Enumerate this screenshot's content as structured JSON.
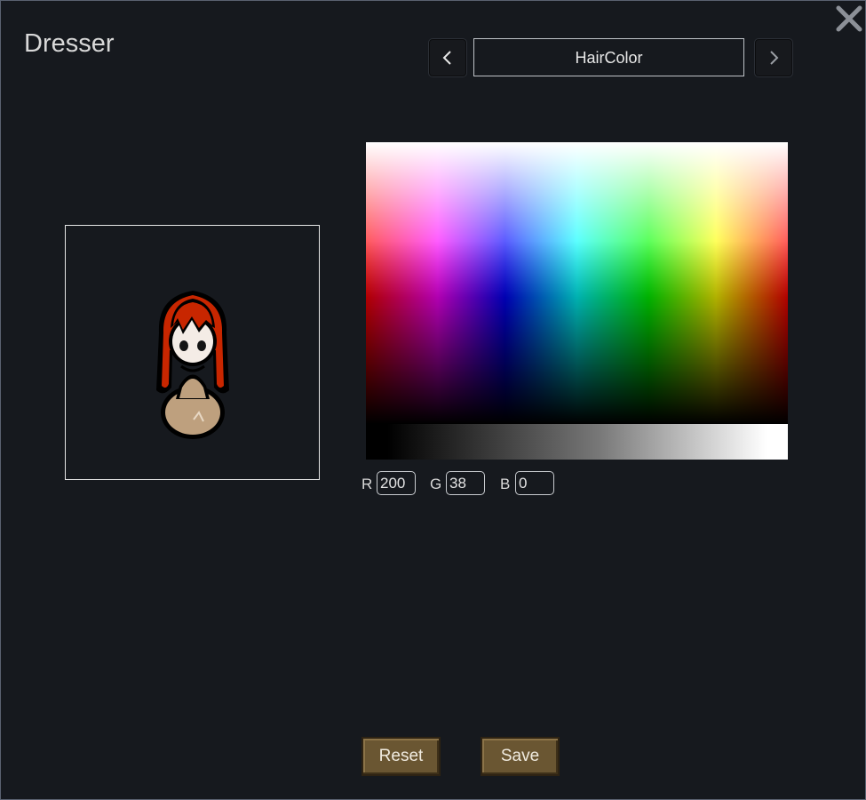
{
  "window": {
    "title": "Dresser",
    "close_icon": "close-icon"
  },
  "category_selector": {
    "prev_icon": "chevron-left-icon",
    "label": "HairColor",
    "next_icon": "chevron-right-icon"
  },
  "color": {
    "r_label": "R",
    "r_value": "200",
    "g_label": "G",
    "g_value": "38",
    "b_label": "B",
    "b_value": "0",
    "hair_hex": "#c82600"
  },
  "actions": {
    "reset_label": "Reset",
    "save_label": "Save"
  },
  "colors": {
    "background": "#16191e",
    "button": "#6a5632",
    "skin": "#bea07e"
  }
}
